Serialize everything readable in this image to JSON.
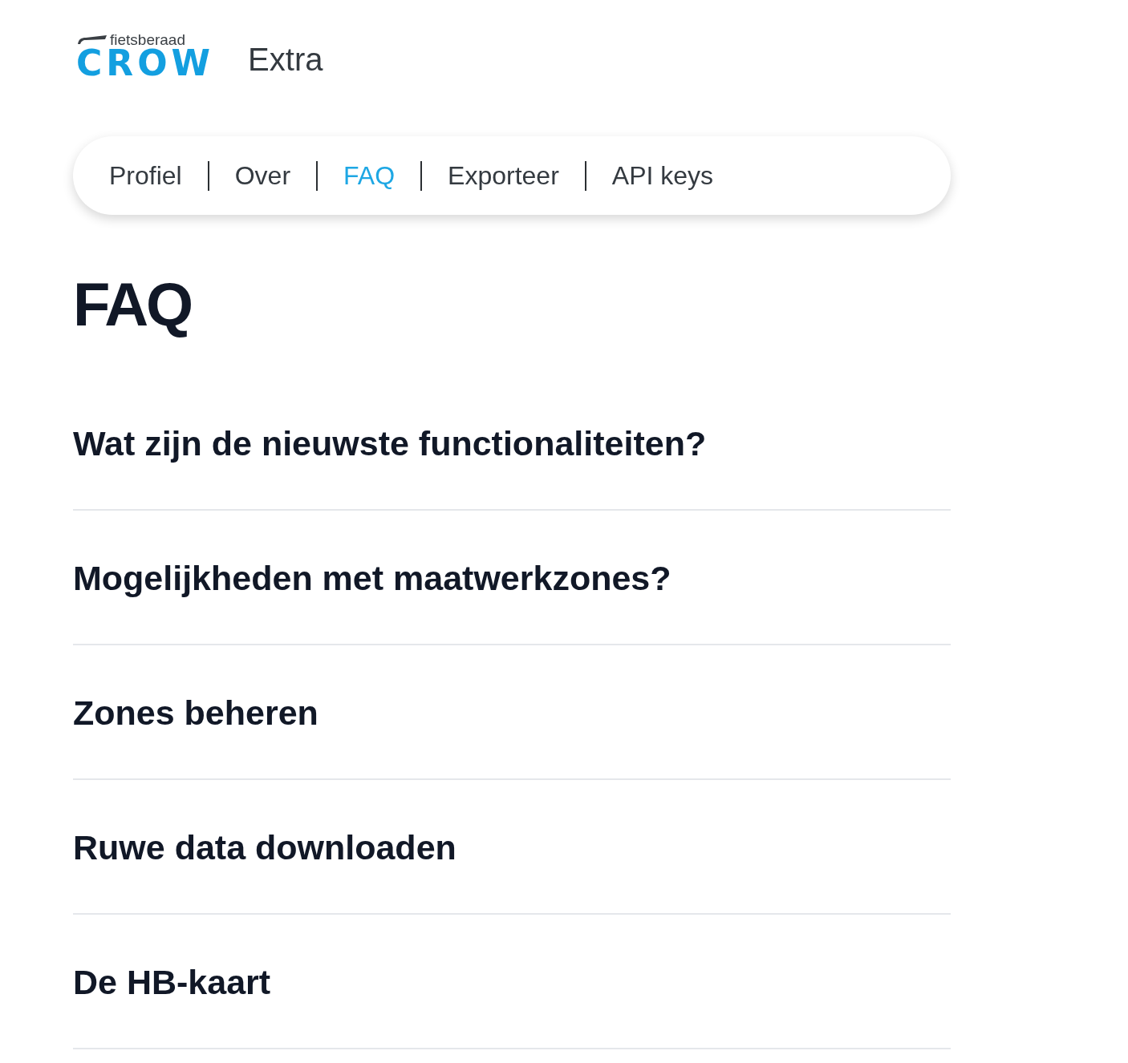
{
  "header": {
    "logo": {
      "tagline": "fietsberaad",
      "wordmark": "CROW"
    },
    "title": "Extra"
  },
  "nav": {
    "items": [
      {
        "label": "Profiel",
        "selected": false
      },
      {
        "label": "Over",
        "selected": false
      },
      {
        "label": "FAQ",
        "selected": true
      },
      {
        "label": "Exporteer",
        "selected": false
      },
      {
        "label": "API keys",
        "selected": false
      }
    ]
  },
  "page": {
    "heading": "FAQ"
  },
  "faq": {
    "items": [
      {
        "question": "Wat zijn de nieuwste functionaliteiten?"
      },
      {
        "question": "Mogelijkheden met maatwerkzones?"
      },
      {
        "question": "Zones beheren"
      },
      {
        "question": "Ruwe data downloaden"
      },
      {
        "question": "De HB-kaart"
      }
    ]
  }
}
